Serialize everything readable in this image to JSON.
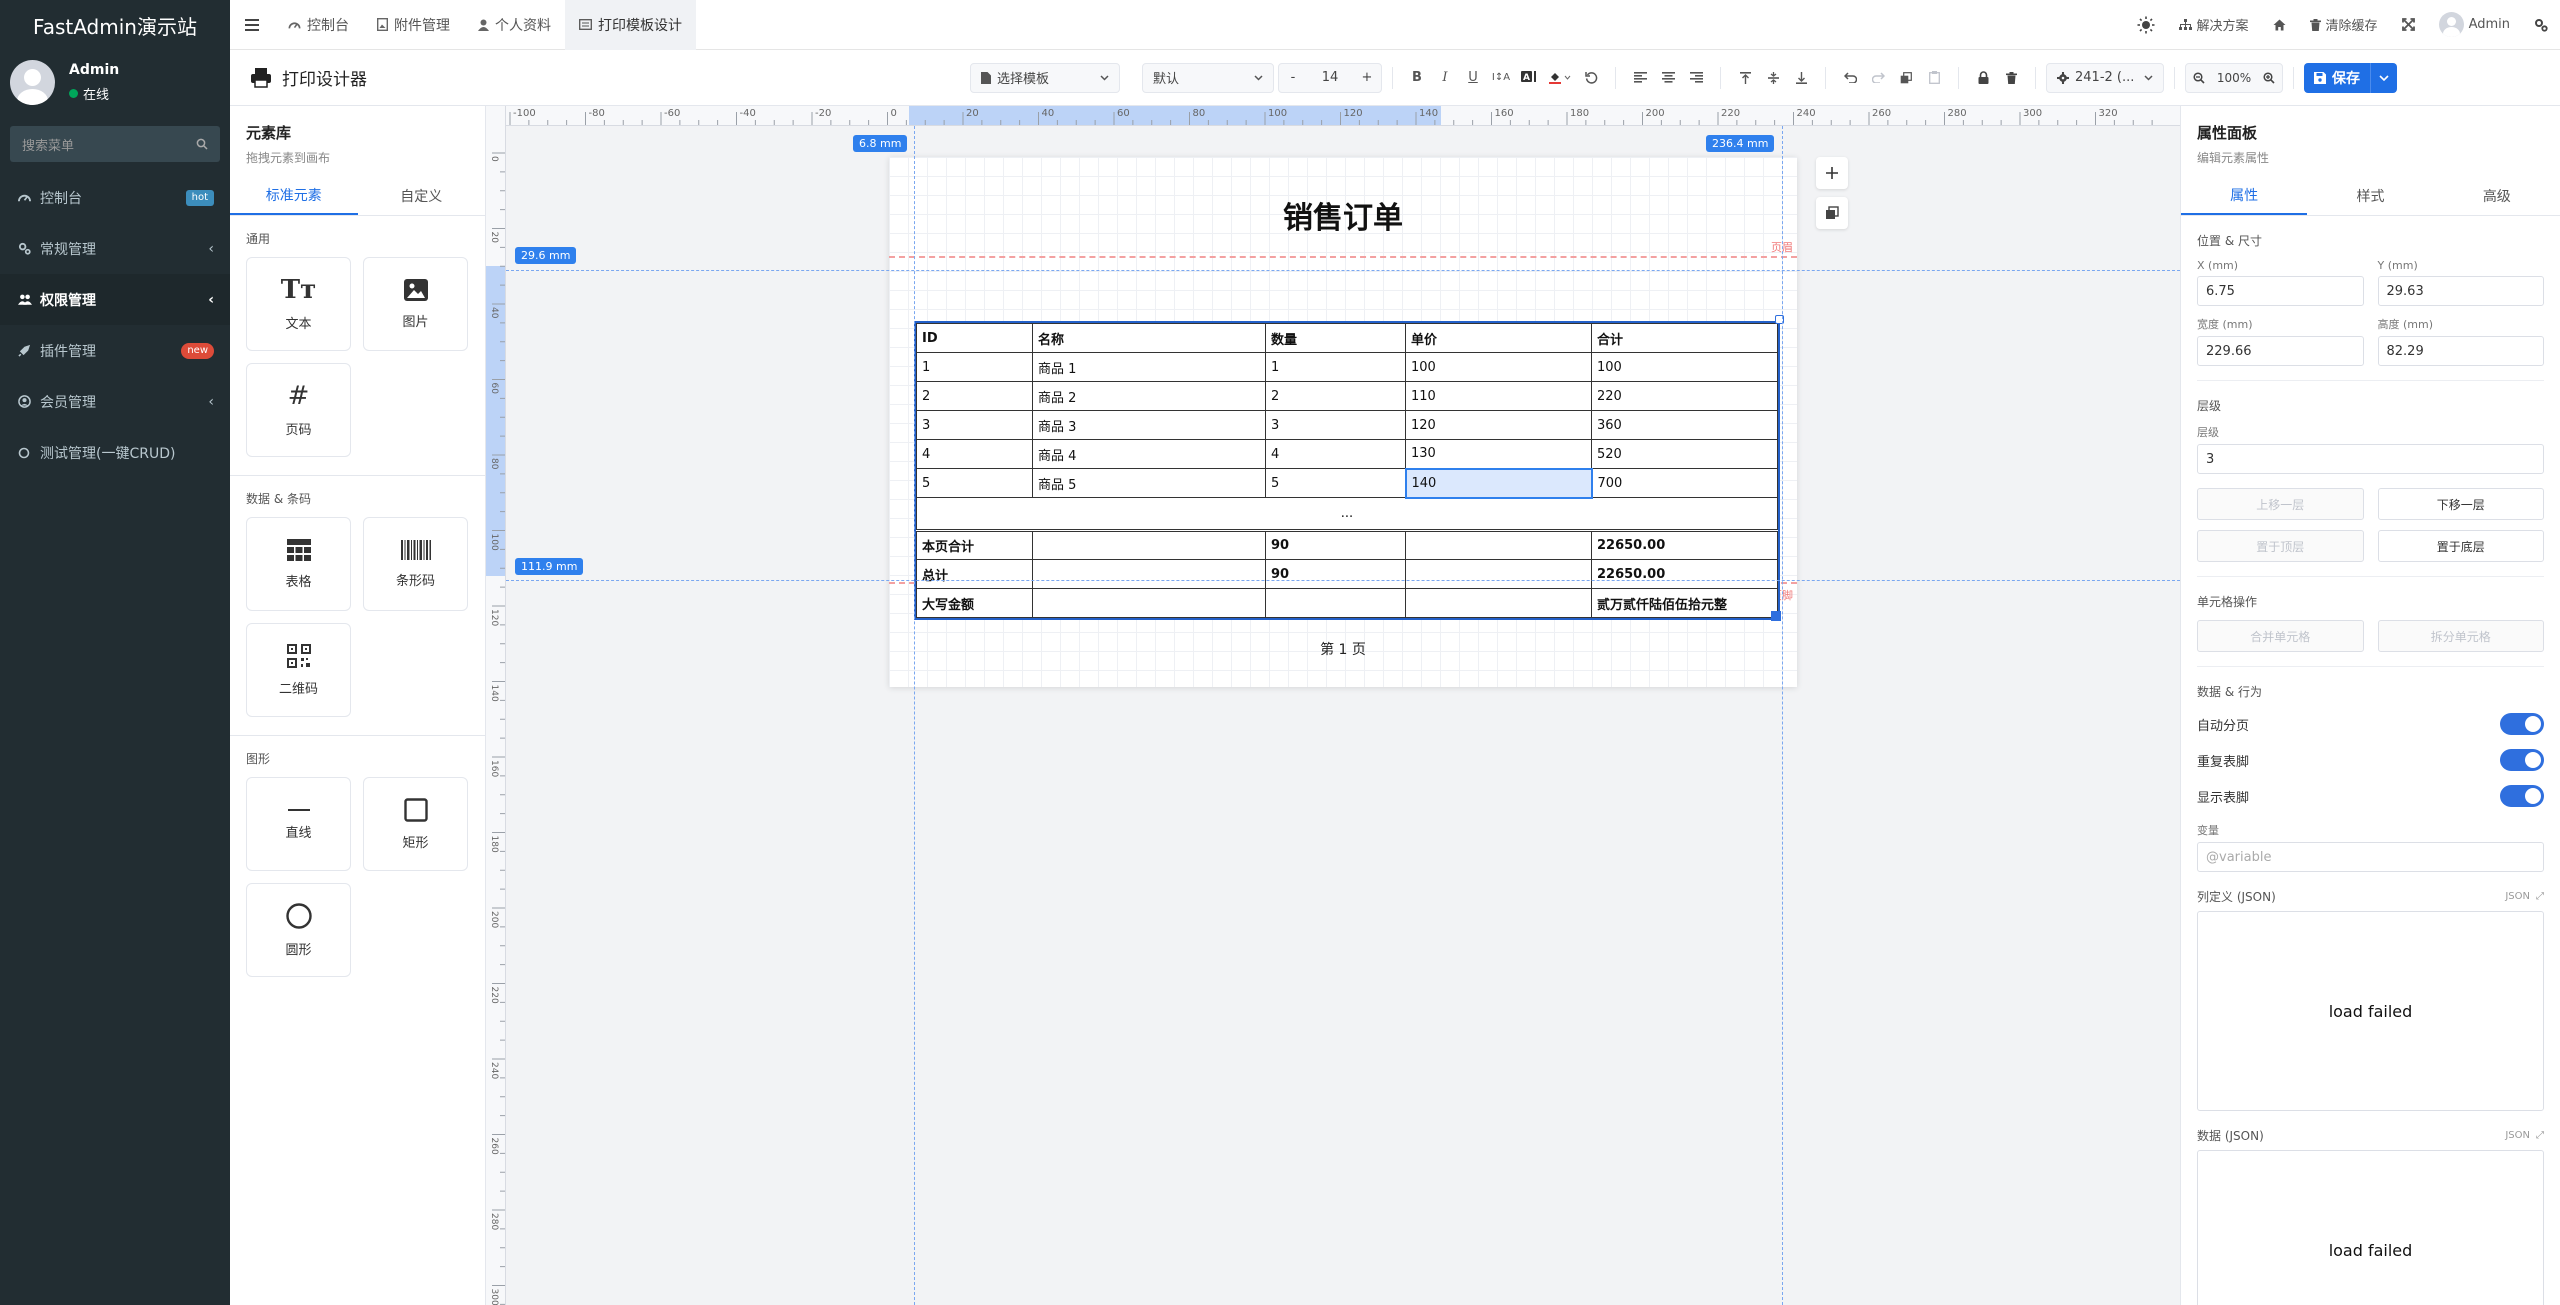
{
  "app": {
    "brand": "FastAdmin演示站"
  },
  "sidebar": {
    "user": {
      "name": "Admin",
      "status": "在线"
    },
    "search_placeholder": "搜索菜单",
    "items": [
      {
        "label": "控制台",
        "badge": "hot",
        "icon": "dashboard-icon"
      },
      {
        "label": "常规管理",
        "icon": "cogs-icon"
      },
      {
        "label": "权限管理",
        "icon": "users-icon",
        "active": true
      },
      {
        "label": "插件管理",
        "badge": "new",
        "icon": "rocket-icon"
      },
      {
        "label": "会员管理",
        "icon": "user-circle-icon"
      },
      {
        "label": "测试管理(一键CRUD)",
        "icon": "circle-icon"
      }
    ]
  },
  "header": {
    "tabs": [
      {
        "label": "控制台"
      },
      {
        "label": "附件管理"
      },
      {
        "label": "个人资料"
      },
      {
        "label": "打印模板设计",
        "active": true
      }
    ],
    "right": {
      "solutions": "解决方案",
      "clear_cache": "清除缓存",
      "user": "Admin"
    }
  },
  "toolbar": {
    "title": "打印设计器",
    "template_select": "选择模板",
    "font_select": "默认",
    "font_size": "14",
    "minus": "-",
    "plus": "+",
    "paper_select": "241-2 (...",
    "zoom": "100%",
    "save": "保存"
  },
  "library": {
    "title": "元素库",
    "subtitle": "拖拽元素到画布",
    "tabs": [
      "标准元素",
      "自定义"
    ],
    "groups": [
      {
        "title": "通用",
        "items": [
          "文本",
          "图片",
          "页码"
        ]
      },
      {
        "title": "数据 & 条码",
        "items": [
          "表格",
          "条形码",
          "二维码"
        ]
      },
      {
        "title": "图形",
        "items": [
          "直线",
          "矩形",
          "圆形"
        ]
      }
    ]
  },
  "canvas": {
    "ruler_h": [
      "-100",
      "-80",
      "-60",
      "-40",
      "-20",
      "0",
      "20",
      "40",
      "60",
      "80",
      "100",
      "120",
      "140",
      "160",
      "180",
      "200",
      "220",
      "240",
      "260",
      "280",
      "300",
      "320"
    ],
    "ruler_v": [
      "0",
      "20",
      "40",
      "60",
      "80",
      "100",
      "120",
      "140",
      "160",
      "180",
      "200",
      "220",
      "240",
      "260",
      "280",
      "300"
    ],
    "tag_left": "6.8 mm",
    "tag_right": "236.4 mm",
    "tag_top": "29.6 mm",
    "tag_bottom": "111.9 mm",
    "header_label": "页眉",
    "footer_label": "页脚",
    "doc_title": "销售订单",
    "page_footer": "第 1 页",
    "table": {
      "headers": [
        "ID",
        "名称",
        "数量",
        "单价",
        "合计"
      ],
      "rows": [
        [
          "1",
          "商品 1",
          "1",
          "100",
          "100"
        ],
        [
          "2",
          "商品 2",
          "2",
          "110",
          "220"
        ],
        [
          "3",
          "商品 3",
          "3",
          "120",
          "360"
        ],
        [
          "4",
          "商品 4",
          "4",
          "130",
          "520"
        ],
        [
          "5",
          "商品 5",
          "5",
          "140",
          "700"
        ]
      ],
      "ellipsis": "...",
      "footer_rows": [
        [
          "本页合计",
          "",
          "90",
          "",
          "22650.00"
        ],
        [
          "总计",
          "",
          "90",
          "",
          "22650.00"
        ],
        [
          "大写金额",
          "",
          "",
          "",
          "贰万贰仟陆佰伍拾元整"
        ]
      ]
    }
  },
  "props": {
    "title": "属性面板",
    "subtitle": "编辑元素属性",
    "tabs": [
      "属性",
      "样式",
      "高级"
    ],
    "pos_title": "位置 & 尺寸",
    "x_label": "X (mm)",
    "x": "6.75",
    "y_label": "Y (mm)",
    "y": "29.63",
    "w_label": "宽度 (mm)",
    "w": "229.66",
    "h_label": "高度 (mm)",
    "h": "82.29",
    "layer_title": "层级",
    "layer_label": "层级",
    "layer": "3",
    "btn_up": "上移一层",
    "btn_down": "下移一层",
    "btn_top": "置于顶层",
    "btn_bottom": "置于底层",
    "cell_title": "单元格操作",
    "btn_merge": "合并单元格",
    "btn_split": "拆分单元格",
    "data_title": "数据 & 行为",
    "toggle_1": "自动分页",
    "toggle_2": "重复表脚",
    "toggle_3": "显示表脚",
    "var_label": "变量",
    "var_placeholder": "@variable",
    "coldef_label": "列定义 (JSON)",
    "json_tag": "JSON",
    "coldef_status": "load failed",
    "data_label": "数据 (JSON)",
    "data_status": "load failed"
  }
}
